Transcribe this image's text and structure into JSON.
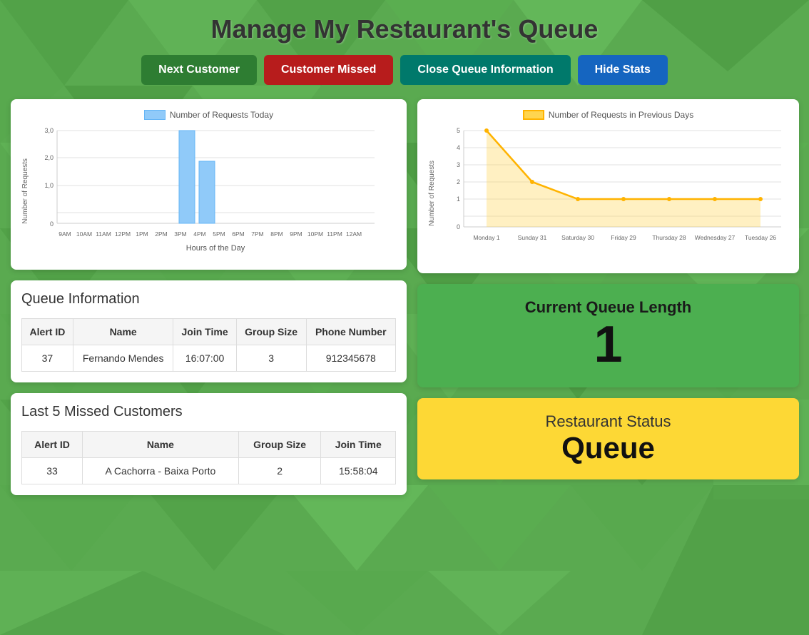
{
  "page": {
    "title": "Manage My Restaurant's Queue"
  },
  "buttons": {
    "next_customer": "Next Customer",
    "customer_missed": "Customer Missed",
    "close_queue": "Close Queue Information",
    "hide_stats": "Hide Stats"
  },
  "chart_today": {
    "legend": "Number of Requests Today",
    "y_label": "Number of Requests",
    "x_label": "Hours of the Day",
    "x_ticks": [
      "9AM",
      "10AM",
      "11AM",
      "12PM",
      "1PM",
      "2PM",
      "3PM",
      "4PM",
      "5PM",
      "6PM",
      "7PM",
      "8PM",
      "9PM",
      "10PM",
      "11PM",
      "12AM"
    ],
    "y_ticks": [
      "3,0",
      "2,0",
      "1,0",
      "0"
    ],
    "bars": [
      {
        "hour": "3PM",
        "value": 3
      },
      {
        "hour": "4PM",
        "value": 2
      }
    ]
  },
  "chart_previous": {
    "legend": "Number of Requests in Previous Days",
    "y_label": "Number of Requests",
    "x_ticks": [
      "Monday 1",
      "Sunday 31",
      "Saturday 30",
      "Friday 29",
      "Thursday 28",
      "Wednesday 27",
      "Tuesday 26"
    ],
    "y_ticks": [
      "5",
      "4",
      "3",
      "2",
      "1",
      "0"
    ],
    "data_points": [
      {
        "day": "Monday 1",
        "value": 5
      },
      {
        "day": "Sunday 31",
        "value": 2
      },
      {
        "day": "Saturday 30",
        "value": 1
      },
      {
        "day": "Friday 29",
        "value": 1
      },
      {
        "day": "Thursday 28",
        "value": 1
      },
      {
        "day": "Wednesday 27",
        "value": 1
      },
      {
        "day": "Tuesday 26",
        "value": 1
      }
    ]
  },
  "queue_info": {
    "title": "Queue Information",
    "headers": [
      "Alert ID",
      "Name",
      "Join Time",
      "Group Size",
      "Phone Number"
    ],
    "rows": [
      {
        "alert_id": "37",
        "name": "Fernando Mendes",
        "join_time": "16:07:00",
        "group_size": "3",
        "phone": "912345678"
      }
    ]
  },
  "missed_customers": {
    "title": "Last 5 Missed Customers",
    "headers": [
      "Alert ID",
      "Name",
      "Group Size",
      "Join Time"
    ],
    "rows": [
      {
        "alert_id": "33",
        "name": "A Cachorra - Baixa Porto",
        "group_size": "2",
        "join_time": "15:58:04"
      }
    ]
  },
  "queue_length": {
    "title": "Current Queue Length",
    "value": "1"
  },
  "restaurant_status": {
    "title": "Restaurant Status",
    "value": "Queue"
  }
}
